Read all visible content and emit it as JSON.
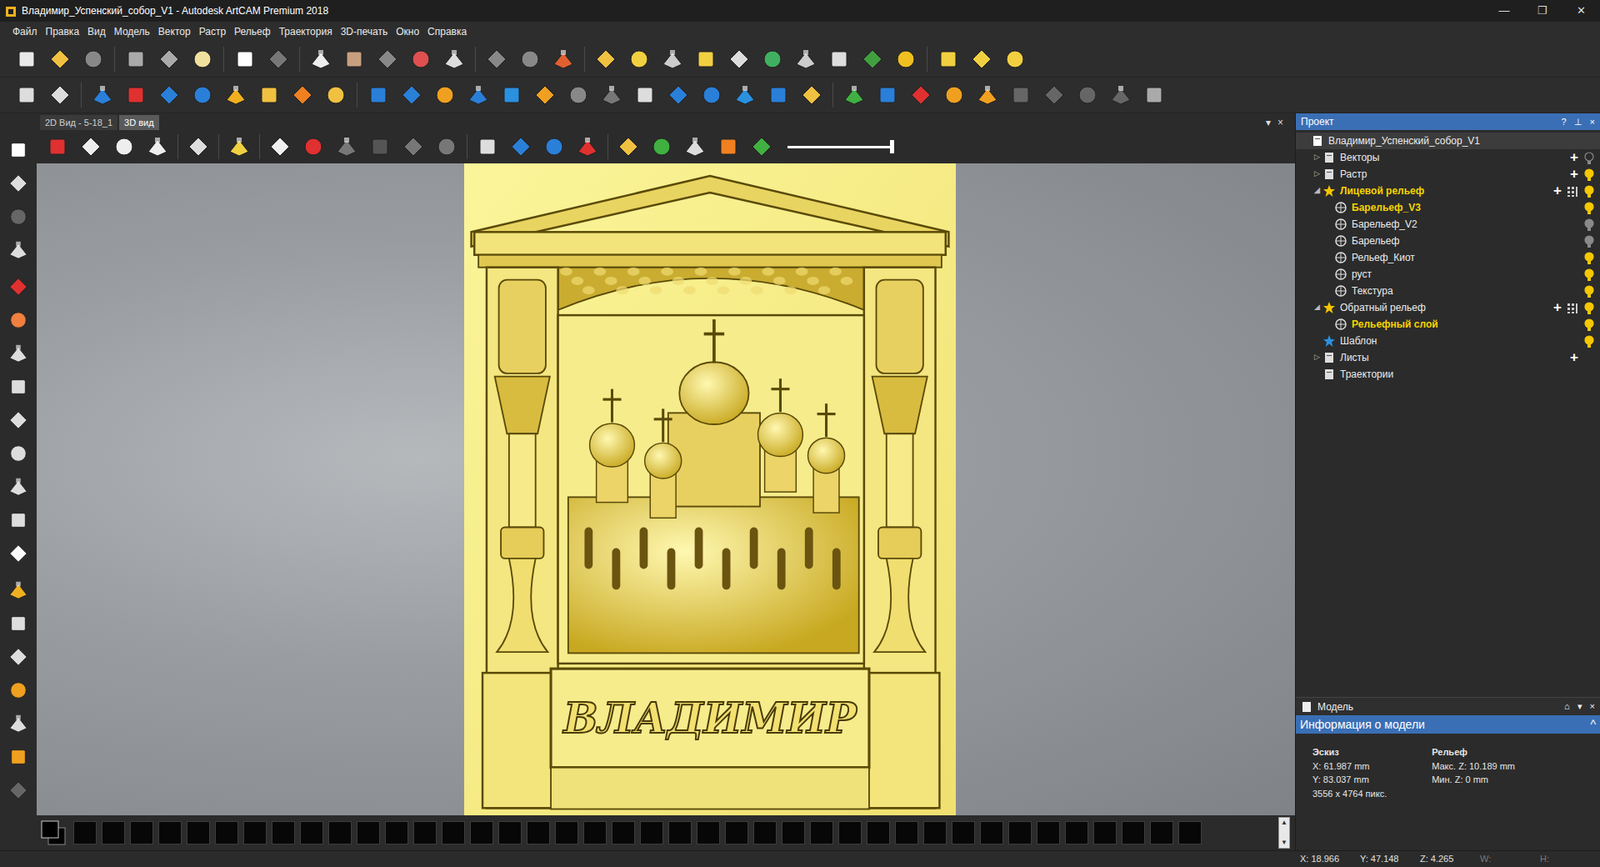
{
  "window": {
    "title": "Владимир_Успенский_собор_V1 - Autodesk ArtCAM Premium 2018",
    "controls": [
      "—",
      "❐",
      "✕"
    ]
  },
  "menu": [
    "Файл",
    "Правка",
    "Вид",
    "Модель",
    "Вектор",
    "Растр",
    "Рельеф",
    "Траектория",
    "3D-печать",
    "Окно",
    "Справка"
  ],
  "view_tabs": [
    {
      "label": "2D Вид - 5-18_1",
      "selected": false
    },
    {
      "label": "3D вид",
      "selected": true
    }
  ],
  "view_tab_controls": [
    "▾",
    "×"
  ],
  "view_toolbar": {
    "slider": {
      "level": 1
    }
  },
  "relief": {
    "caption": "ВЛАДИМИР"
  },
  "project_panel": {
    "title": "Проект",
    "controls": [
      "?",
      "⊥",
      "×"
    ],
    "tree": [
      {
        "label": "Владимир_Успенский_собор_V1",
        "level": 0,
        "toggle": "",
        "expanded": true,
        "active": false,
        "visible": true,
        "add": "",
        "grid": false,
        "bulb": false
      },
      {
        "label": "Векторы",
        "level": 1,
        "toggle": "▷",
        "expanded": false,
        "active": false,
        "visible": false,
        "add": "+",
        "grid": false,
        "bulb": true
      },
      {
        "label": "Растр",
        "level": 1,
        "toggle": "▷",
        "expanded": false,
        "active": false,
        "visible": true,
        "add": "+",
        "grid": false,
        "bulb": true
      },
      {
        "label": "Лицевой рельеф",
        "level": 1,
        "toggle": "◢",
        "expanded": true,
        "active": true,
        "visible": true,
        "add": "+",
        "grid": true,
        "bulb": true
      },
      {
        "label": "Барельеф_V3",
        "level": 2,
        "toggle": "",
        "expanded": false,
        "active": true,
        "visible": true,
        "add": "",
        "grid": false,
        "bulb": true
      },
      {
        "label": "Барельеф_V2",
        "level": 2,
        "toggle": "",
        "expanded": false,
        "active": false,
        "visible": false,
        "add": "",
        "grid": false,
        "bulb": true
      },
      {
        "label": "Барельеф",
        "level": 2,
        "toggle": "",
        "expanded": false,
        "active": false,
        "visible": false,
        "add": "",
        "grid": false,
        "bulb": true
      },
      {
        "label": "Рельеф_Киот",
        "level": 2,
        "toggle": "",
        "expanded": false,
        "active": false,
        "visible": true,
        "add": "",
        "grid": false,
        "bulb": true
      },
      {
        "label": "руст",
        "level": 2,
        "toggle": "",
        "expanded": false,
        "active": false,
        "visible": true,
        "add": "",
        "grid": false,
        "bulb": true
      },
      {
        "label": "Текстура",
        "level": 2,
        "toggle": "",
        "expanded": false,
        "active": false,
        "visible": true,
        "add": "",
        "grid": false,
        "bulb": true
      },
      {
        "label": "Обратный рельеф",
        "level": 1,
        "toggle": "◢",
        "expanded": true,
        "active": false,
        "visible": true,
        "add": "+",
        "grid": true,
        "bulb": true
      },
      {
        "label": "Рельефный слой",
        "level": 2,
        "toggle": "",
        "expanded": false,
        "active": true,
        "visible": true,
        "add": "",
        "grid": false,
        "bulb": true
      },
      {
        "label": "Шаблон",
        "level": 1,
        "toggle": "",
        "expanded": false,
        "active": false,
        "visible": true,
        "add": "",
        "grid": false,
        "bulb": true
      },
      {
        "label": "Листы",
        "level": 1,
        "toggle": "▷",
        "expanded": false,
        "active": false,
        "visible": true,
        "add": "+",
        "grid": false,
        "bulb": false
      },
      {
        "label": "Траектории",
        "level": 1,
        "toggle": "",
        "expanded": false,
        "active": false,
        "visible": true,
        "add": "",
        "grid": false,
        "bulb": false
      }
    ]
  },
  "model_panel": {
    "title": "Модель",
    "controls": [
      "⌂",
      "▾",
      "×"
    ],
    "section": "Информация о модели",
    "section_toggle": "^",
    "sketch": {
      "heading": "Эскиз",
      "lines": [
        "X: 61.987 mm",
        "Y: 83.037 mm",
        "3556 x 4764 пикс."
      ]
    },
    "relief": {
      "heading": "Рельеф",
      "lines": [
        "Макс. Z: 10.189 mm",
        "Мин. Z: 0 mm"
      ]
    }
  },
  "palette_scroll": [
    "▲",
    "▼"
  ],
  "status_bar": [
    {
      "text": "X: 18.966",
      "disabled": false
    },
    {
      "text": "Y: 47.148",
      "disabled": false
    },
    {
      "text": "Z: 4.265",
      "disabled": false
    },
    {
      "text": "W:",
      "disabled": true
    },
    {
      "text": "H:",
      "disabled": true
    }
  ]
}
